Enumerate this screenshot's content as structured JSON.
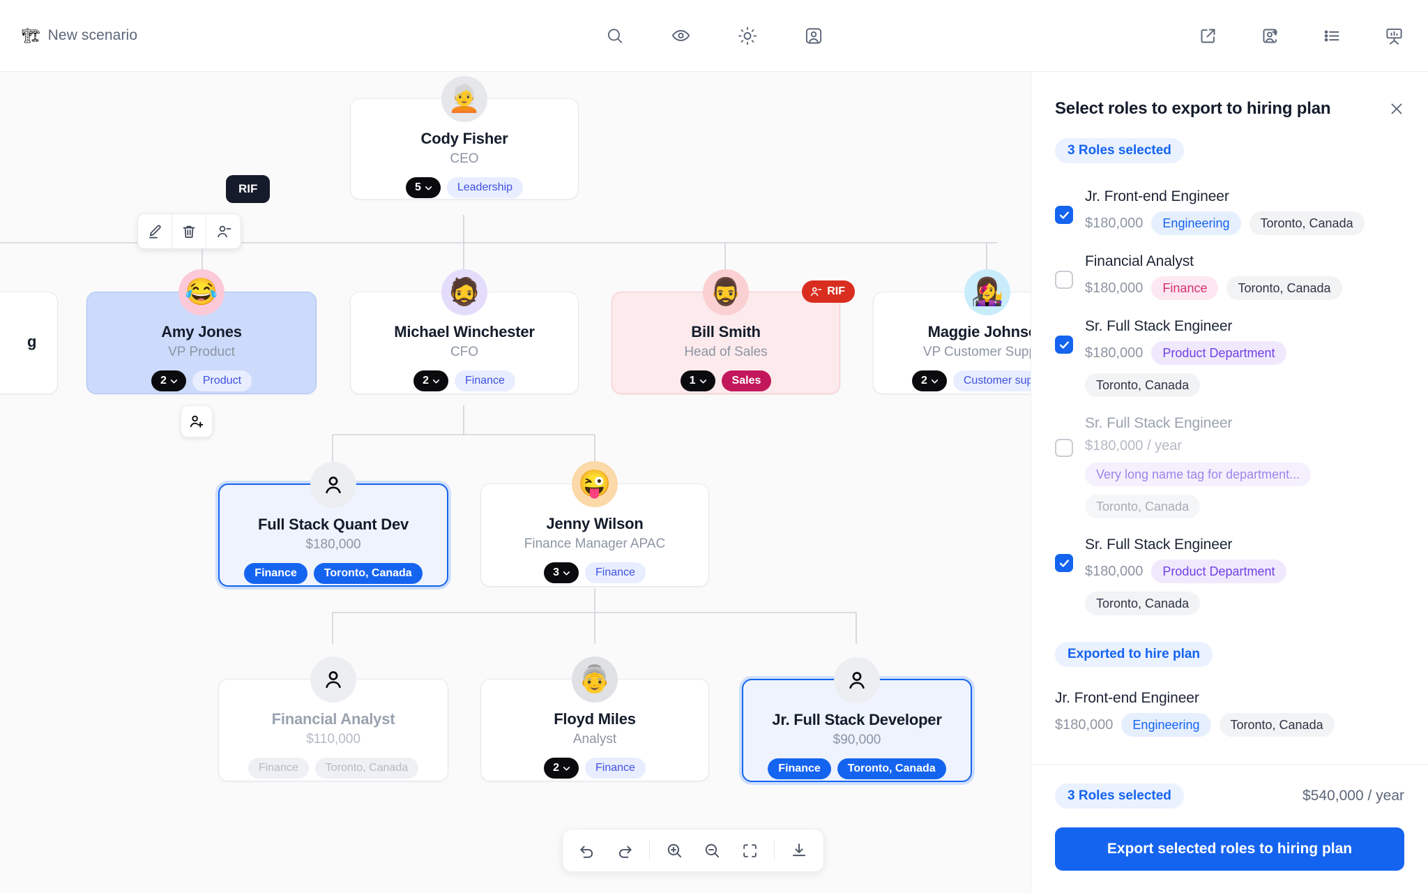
{
  "topbar": {
    "brand_emoji": "🏗",
    "brand_label": "New scenario",
    "center_icons": [
      "search-icon",
      "eye-icon",
      "brightness-icon",
      "person-frame-icon"
    ],
    "right_icons": [
      "share-external-icon",
      "add-person-icon",
      "list-icon",
      "presentation-chart-icon"
    ]
  },
  "chart": {
    "nodes": [
      {
        "id": "cody",
        "name": "Cody Fisher",
        "role": "CEO",
        "count": "5",
        "tag": "Leadership",
        "avatar": "🧑‍🦳"
      },
      {
        "id": "partial_left",
        "name": "g",
        "role": "",
        "count": "",
        "tag": ""
      },
      {
        "id": "amy",
        "name": "Amy Jones",
        "role": "VP Product",
        "count": "2",
        "tag": "Product",
        "avatar": "😂"
      },
      {
        "id": "michael",
        "name": "Michael Winchester",
        "role": "CFO",
        "count": "2",
        "tag": "Finance",
        "avatar": "🧔"
      },
      {
        "id": "bill",
        "name": "Bill Smith",
        "role": "Head of Sales",
        "count": "1",
        "tag": "Sales",
        "badge": "RIF",
        "avatar": "🧔‍♂️"
      },
      {
        "id": "maggie",
        "name": "Maggie Johnson",
        "role": "VP Customer Support",
        "count": "2",
        "tag": "Customer support",
        "avatar": "👩‍🎤"
      },
      {
        "id": "fsqd",
        "name": "Full Stack Quant Dev",
        "role": "$180,000",
        "tags": [
          "Finance",
          "Toronto, Canada"
        ]
      },
      {
        "id": "jenny",
        "name": "Jenny Wilson",
        "role": "Finance Manager APAC",
        "count": "3",
        "tag": "Finance",
        "avatar": "😜"
      },
      {
        "id": "finanalyst",
        "name": "Financial Analyst",
        "role": "$110,000",
        "tags": [
          "Finance",
          "Toronto, Canada"
        ]
      },
      {
        "id": "floyd",
        "name": "Floyd Miles",
        "role": "Analyst",
        "count": "2",
        "tag": "Finance",
        "avatar": "👵"
      },
      {
        "id": "jrfsd",
        "name": "Jr. Full Stack Developer",
        "role": "$90,000",
        "tags": [
          "Finance",
          "Toronto, Canada"
        ]
      }
    ],
    "hover_tooltip": "RIF",
    "hover_tools": [
      "edit-icon",
      "delete-icon",
      "person-minus-icon"
    ],
    "add_person_fab": "add-person-icon",
    "bottom_toolbar": [
      "undo-icon",
      "redo-icon",
      "zoom-in-icon",
      "zoom-out-icon",
      "fit-screen-icon",
      "download-icon"
    ]
  },
  "panel": {
    "title": "Select roles to export to hiring plan",
    "close_icon": "close-icon",
    "selected_chip": "3 Roles selected",
    "roles": [
      {
        "name": "Jr. Front-end Engineer",
        "salary": "$180,000",
        "dept": "Engineering",
        "dept_style": "blue",
        "location": "Toronto, Canada",
        "checked": true,
        "disabled": false
      },
      {
        "name": "Financial Analyst",
        "salary": "$180,000",
        "dept": "Finance",
        "dept_style": "pink",
        "location": "Toronto, Canada",
        "checked": false,
        "disabled": false
      },
      {
        "name": "Sr. Full Stack Engineer",
        "salary": "$180,000",
        "dept": "Product Department",
        "dept_style": "violet",
        "location": "Toronto, Canada",
        "checked": true,
        "disabled": false
      },
      {
        "name": "Sr. Full Stack Engineer",
        "salary": "$180,000 / year",
        "dept": "Very long name tag for department...",
        "dept_style": "violet",
        "location": "Toronto, Canada",
        "checked": false,
        "disabled": true
      },
      {
        "name": "Sr. Full Stack Engineer",
        "salary": "$180,000",
        "dept": "Product Department",
        "dept_style": "violet",
        "location": "Toronto, Canada",
        "checked": true,
        "disabled": false
      }
    ],
    "exported_chip": "Exported to hire plan",
    "exported": [
      {
        "name": "Jr. Front-end Engineer",
        "salary": "$180,000",
        "dept": "Engineering",
        "dept_style": "blue",
        "location": "Toronto, Canada"
      }
    ],
    "footer": {
      "selected_chip": "3 Roles selected",
      "total": "$540,000 / year",
      "export_button": "Export selected roles to hiring plan"
    }
  },
  "colors": {
    "accent": "#1564f0",
    "rif": "#d92d20",
    "sales_tag": "#c2185b",
    "violet_tag": "#7040e3"
  }
}
